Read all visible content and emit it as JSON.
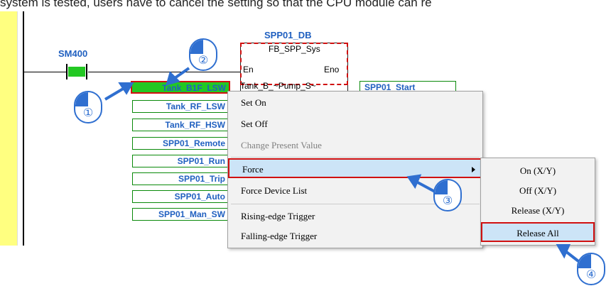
{
  "caption": "system is tested, users have to cancel the setting so that the CPU module can re",
  "contact": {
    "label": "SM400"
  },
  "function_block": {
    "instance_name": "SPP01_DB",
    "type_name": "FB_SPP_Sys",
    "en": "En",
    "eno": "Eno",
    "first_input_pin": "Tank_B_~Pump_S~"
  },
  "input_variables": [
    "Tank_B1F_LSW",
    "Tank_RF_LSW",
    "Tank_RF_HSW",
    "SPP01_Remote",
    "SPP01_Run",
    "SPP01_Trip",
    "SPP01_Auto",
    "SPP01_Man_SW"
  ],
  "output_variable": "SPP01_Start",
  "context_menu": {
    "items": [
      {
        "label": "Set On",
        "enabled": true
      },
      {
        "label": "Set Off",
        "enabled": true
      },
      {
        "label": "Change Present Value",
        "enabled": false
      },
      {
        "label": "Force",
        "enabled": true,
        "has_submenu": true,
        "highlighted": true
      },
      {
        "label": "Force Device List",
        "enabled": true
      },
      {
        "label": "Rising-edge Trigger",
        "enabled": true
      },
      {
        "label": "Falling-edge Trigger",
        "enabled": true
      }
    ]
  },
  "submenu": {
    "items": [
      {
        "label": "On (X/Y)"
      },
      {
        "label": "Off (X/Y)"
      },
      {
        "label": "Release (X/Y)"
      },
      {
        "label": "Release All",
        "highlighted": true
      }
    ]
  },
  "step_markers": [
    "①",
    "②",
    "③",
    "④"
  ],
  "colors": {
    "contact_on": "#23c823",
    "highlight_box": "#d01010",
    "label_blue": "#2060c0",
    "menu_highlight": "#cce4f7",
    "callout_blue": "#2f6fd0",
    "left_bar": "#ffff80"
  }
}
